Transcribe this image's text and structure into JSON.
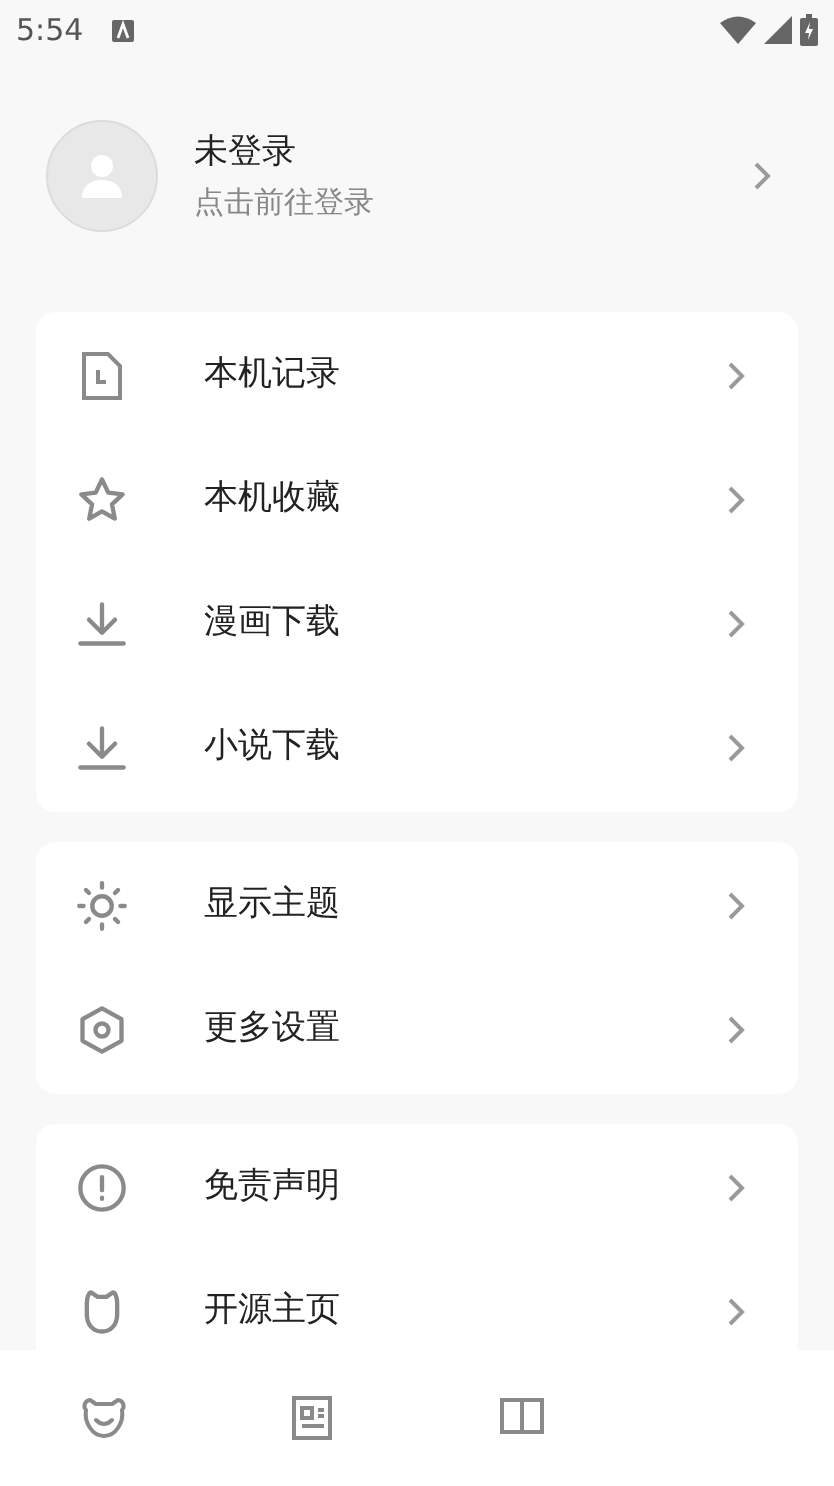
{
  "status_bar": {
    "time": "5:54"
  },
  "profile": {
    "name": "未登录",
    "hint": "点击前往登录"
  },
  "sections": [
    {
      "items": [
        {
          "label": "本机记录"
        },
        {
          "label": "本机收藏"
        },
        {
          "label": "漫画下载"
        },
        {
          "label": "小说下载"
        }
      ]
    },
    {
      "items": [
        {
          "label": "显示主题"
        },
        {
          "label": "更多设置"
        }
      ]
    },
    {
      "items": [
        {
          "label": "免责声明"
        },
        {
          "label": "开源主页"
        }
      ]
    }
  ]
}
